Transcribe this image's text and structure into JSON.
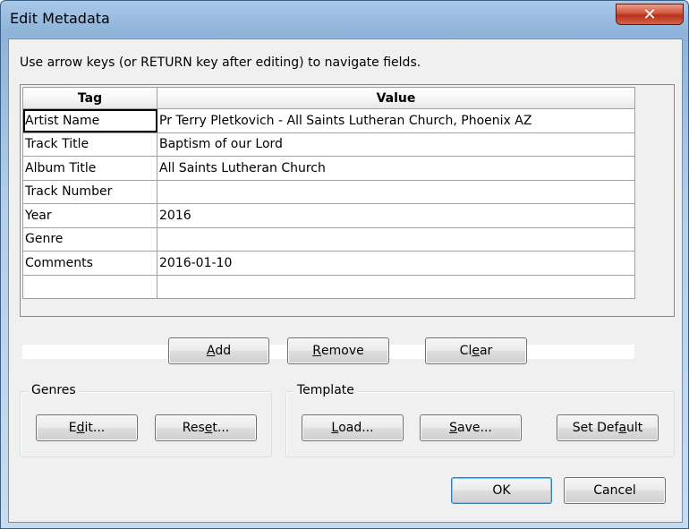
{
  "window": {
    "title": "Edit Metadata",
    "close_label": "✕"
  },
  "instruction": "Use arrow keys (or RETURN key after editing) to navigate fields.",
  "table": {
    "headers": {
      "tag": "Tag",
      "value": "Value"
    },
    "rows": [
      {
        "tag": "Artist Name",
        "value": "Pr Terry Pletkovich - All Saints Lutheran Church, Phoenix AZ"
      },
      {
        "tag": "Track Title",
        "value": "Baptism of our Lord"
      },
      {
        "tag": "Album Title",
        "value": "All Saints Lutheran Church"
      },
      {
        "tag": "Track Number",
        "value": ""
      },
      {
        "tag": "Year",
        "value": "2016"
      },
      {
        "tag": "Genre",
        "value": ""
      },
      {
        "tag": "Comments",
        "value": "2016-01-10"
      },
      {
        "tag": "",
        "value": ""
      }
    ]
  },
  "buttons": {
    "add": {
      "pre": "",
      "u": "A",
      "post": "dd"
    },
    "remove": {
      "pre": "",
      "u": "R",
      "post": "emove"
    },
    "clear": {
      "pre": "Cl",
      "u": "e",
      "post": "ar"
    },
    "genres_edit": {
      "pre": "E",
      "u": "d",
      "post": "it..."
    },
    "genres_reset": {
      "pre": "Res",
      "u": "e",
      "post": "t..."
    },
    "template_load": {
      "pre": "",
      "u": "L",
      "post": "oad..."
    },
    "template_save": {
      "pre": "",
      "u": "S",
      "post": "ave..."
    },
    "template_set_default": {
      "pre": "Set Def",
      "u": "a",
      "post": "ult"
    },
    "ok": "OK",
    "cancel": "Cancel"
  },
  "groups": {
    "genres": "Genres",
    "template": "Template"
  }
}
